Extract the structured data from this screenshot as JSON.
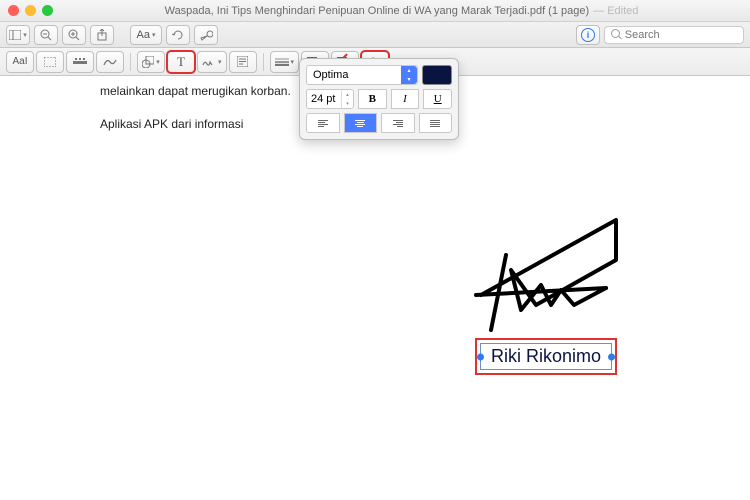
{
  "window": {
    "title": "Waspada, Ini Tips Menghindari Penipuan Online di WA yang Marak Terjadi.pdf (1 page)",
    "edited": "— Edited"
  },
  "toolbar": {
    "search_placeholder": "Search",
    "highlight_label": "Aa"
  },
  "markup": {
    "text_tool": "T",
    "font_style_glyph": "A"
  },
  "text_popover": {
    "font": "Optima",
    "size": "24 pt",
    "bold": "B",
    "italic": "I",
    "underline": "U"
  },
  "document": {
    "line1": "melainkan dapat merugikan korban.",
    "line2": "Aplikasi APK dari informasi"
  },
  "annotation": {
    "text": "Riki Rikonimo"
  },
  "info_glyph": "i"
}
